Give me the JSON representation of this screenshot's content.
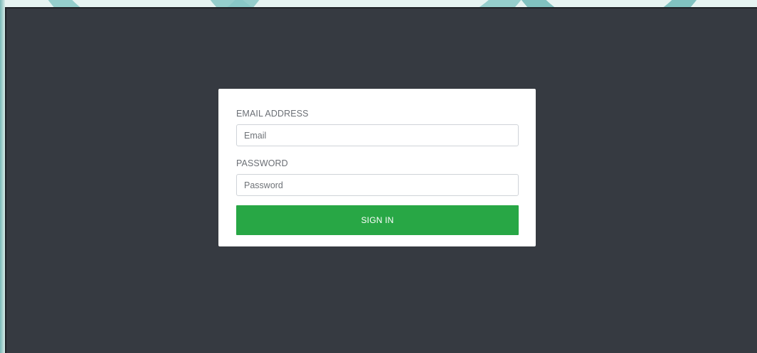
{
  "login_form": {
    "email": {
      "label": "EMAIL ADDRESS",
      "value": "",
      "placeholder": "Email"
    },
    "password": {
      "label": "PASSWORD",
      "value": "",
      "placeholder": "Password"
    },
    "sign_in_label": "SIGN IN"
  },
  "colors": {
    "app_background": "#363a41",
    "card_background": "#ffffff",
    "primary_button": "#28a745",
    "page_background_accent": "#86c7c5"
  }
}
